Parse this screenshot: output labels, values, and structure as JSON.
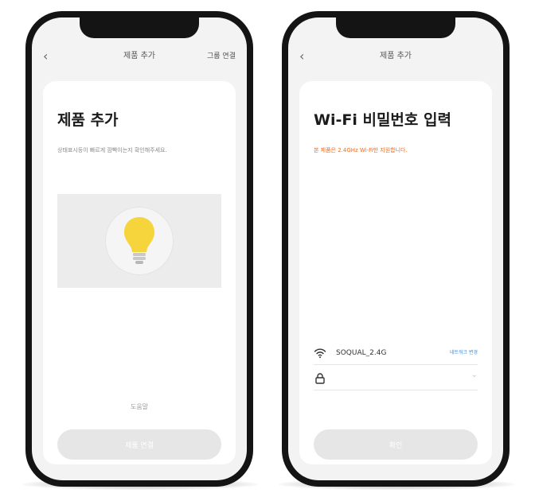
{
  "left_screen": {
    "header": {
      "back_icon": "chevron-left-icon",
      "title": "제품 추가",
      "right_action": "그룹 연결"
    },
    "page_title": "제품 추가",
    "subtitle": "상태표시등이 빠르게 깜빡이는지 확인해주세요.",
    "illustration_icon": "light-bulb-icon",
    "bulb_color": "#f6d43c",
    "link_text": "도움말",
    "primary_button": "제품 연결"
  },
  "right_screen": {
    "header": {
      "back_icon": "chevron-left-icon",
      "title": "제품 추가"
    },
    "page_title": "Wi-Fi 비밀번호 입력",
    "warning": "본 제품은 2.4GHz Wi-Fi만 지원합니다.",
    "warning_color": "#f26a1b",
    "wifi_icon": "wifi-icon",
    "ssid": "SOQUAL_2.4G",
    "change_network": "네트워크 변경",
    "lock_icon": "lock-icon",
    "password_value": "",
    "password_placeholder": "",
    "toggle_icon": "chevron-down-icon",
    "primary_button": "확인"
  }
}
